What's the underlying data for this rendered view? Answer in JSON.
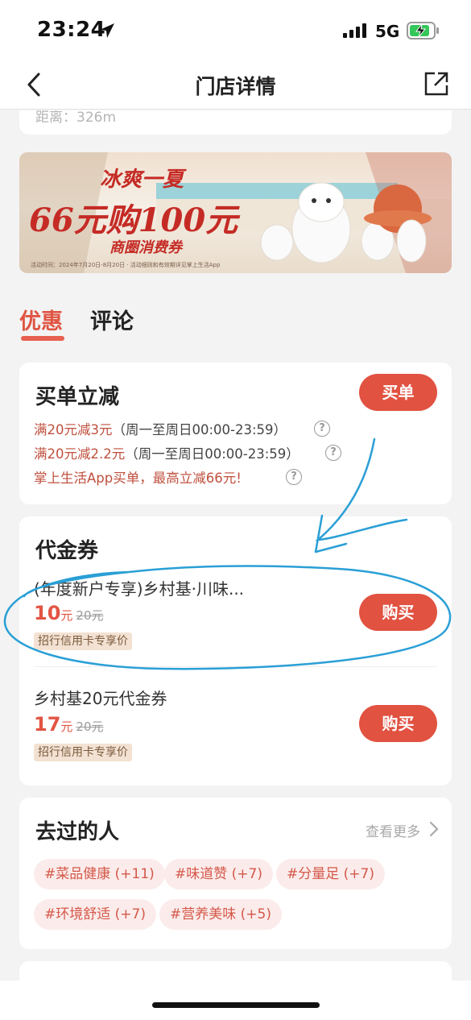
{
  "status_bar": {
    "time": "23:24",
    "network": "5G",
    "icons": [
      "location-arrow-icon",
      "signal-icon",
      "battery-charging-icon"
    ]
  },
  "nav": {
    "title": "门店详情",
    "back_icon": "chevron-left-icon",
    "share_icon": "share-icon"
  },
  "store": {
    "distance": "距离：326m"
  },
  "banner": {
    "headline_1": "冰爽一夏",
    "headline_2": "66元购100元",
    "headline_3": "商圈消费券",
    "fine_print": "活动时间：2024年7月20日-8月20日 · 活动细则和有效期详见掌上生活App"
  },
  "tabs": [
    {
      "label": "优惠",
      "active": true
    },
    {
      "label": "评论",
      "active": false
    }
  ],
  "discount_card": {
    "title": "买单立减",
    "button": "买单",
    "promos": [
      {
        "text": "满20元减3元",
        "time": "（周一至周日00:00-23:59）"
      },
      {
        "text": "满20元减2.2元",
        "time": "（周一至周日00:00-23:59）"
      },
      {
        "text": "掌上生活App买单，最高立减66元!",
        "time": ""
      }
    ],
    "help_glyph": "?"
  },
  "voucher_card": {
    "title": "代金券",
    "items": [
      {
        "name": "(年度新户专享)乡村基·川味...",
        "price": "10",
        "unit": "元",
        "original": "20元",
        "tag": "招行信用卡专享价",
        "button": "购买"
      },
      {
        "name": "乡村基20元代金券",
        "price": "17",
        "unit": "元",
        "original": "20元",
        "tag": "招行信用卡专享价",
        "button": "购买"
      }
    ]
  },
  "visitors_card": {
    "title": "去过的人",
    "see_more": "查看更多",
    "tags": [
      "#菜品健康 (+11)",
      "#味道赞 (+7)",
      "#分量足 (+7)",
      "#环境舒适 (+7)",
      "#营养美味 (+5)"
    ]
  },
  "colors": {
    "accent": "#e15241",
    "promo_text": "#c0503f",
    "tag_bg": "#fbeceb",
    "annotation": "#2a9fd6"
  }
}
